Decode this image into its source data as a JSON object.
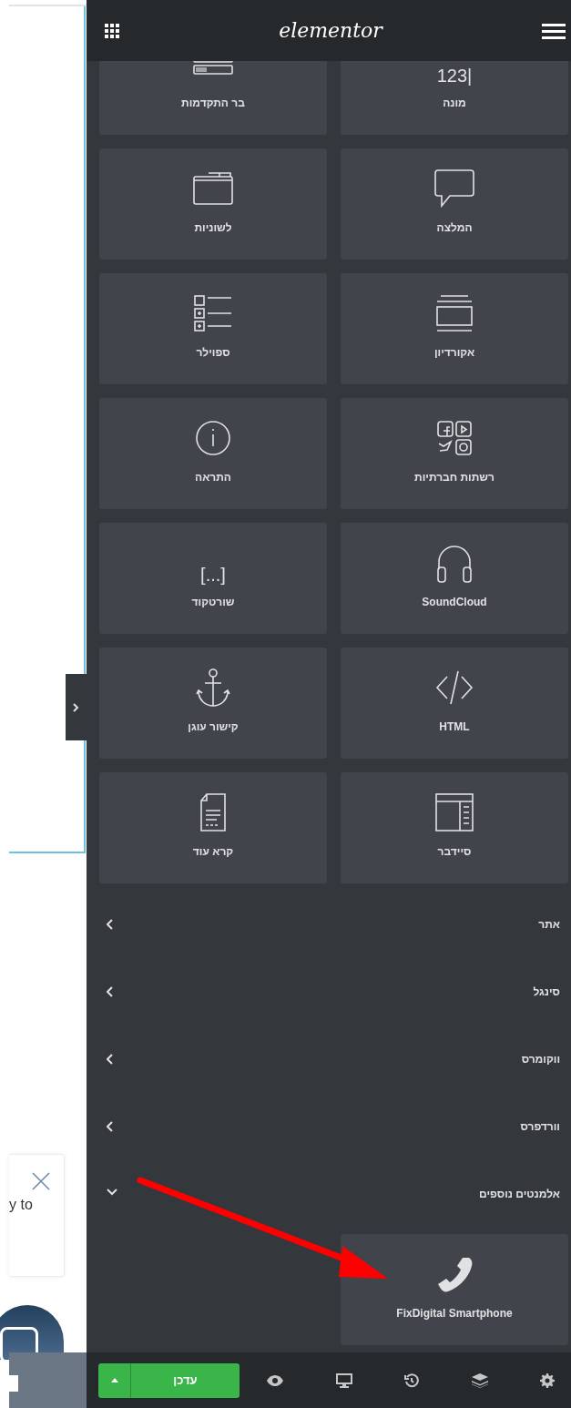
{
  "header": {
    "logo": "elementor"
  },
  "widget_rows": [
    [
      {
        "label": "מונה",
        "kind": "counter",
        "icon_text": "123|"
      },
      {
        "label": "בר התקדמות",
        "kind": "progress"
      }
    ],
    [
      {
        "label": "המלצה",
        "kind": "testimonial"
      },
      {
        "label": "לשוניות",
        "kind": "tabs"
      }
    ],
    [
      {
        "label": "אקורדיון",
        "kind": "accordion"
      },
      {
        "label": "ספוילר",
        "kind": "toggle"
      }
    ],
    [
      {
        "label": "רשתות חברתיות",
        "kind": "social"
      },
      {
        "label": "התראה",
        "kind": "alert"
      }
    ],
    [
      {
        "label": "SoundCloud",
        "kind": "headphones"
      },
      {
        "label": "שורטקוד",
        "kind": "shortcode",
        "icon_text": "[...]"
      }
    ],
    [
      {
        "label": "HTML",
        "kind": "code"
      },
      {
        "label": "קישור עוגן",
        "kind": "anchor"
      }
    ],
    [
      {
        "label": "סיידבר",
        "kind": "sidebar"
      },
      {
        "label": "קרא עוד",
        "kind": "document"
      }
    ]
  ],
  "categories": [
    {
      "title": "אתר",
      "expanded": false
    },
    {
      "title": "סינגל",
      "expanded": false
    },
    {
      "title": "ווקומרס",
      "expanded": false
    },
    {
      "title": "וורדפרס",
      "expanded": false
    },
    {
      "title": "אלמנטים נוספים",
      "expanded": true,
      "widgets": [
        {
          "label": "FixDigital Smartphone",
          "kind": "phone"
        }
      ]
    }
  ],
  "footer": {
    "publish_label": "עדכן"
  },
  "canvas": {
    "popup_text": "y to"
  }
}
